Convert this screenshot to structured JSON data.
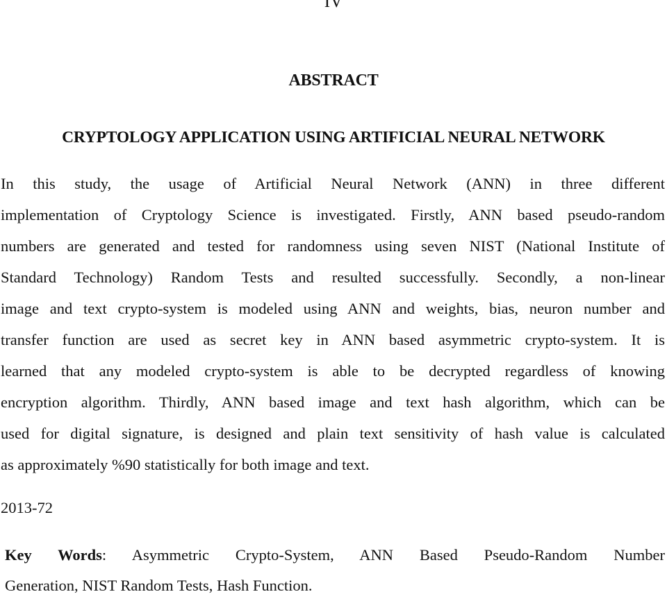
{
  "page": {
    "page_number": "IV"
  },
  "header": {
    "section_heading": "ABSTRACT",
    "thesis_title": "CRYPTOLOGY APPLICATION USING ARTIFICIAL NEURAL NETWORK"
  },
  "abstract": {
    "lines": [
      "In this study, the usage of Artificial Neural Network (ANN) in three different",
      "implementation of Cryptology Science is investigated. Firstly, ANN based pseudo-random",
      "numbers are generated and tested for randomness using seven NIST (National Institute of",
      "Standard Technology) Random Tests and resulted successfully. Secondly, a non-linear",
      "image and text crypto-system is modeled using ANN and weights, bias, neuron number and",
      "transfer function are used as secret key in ANN based asymmetric crypto-system. It is",
      "learned that any modeled crypto-system is able to be decrypted regardless of knowing",
      "encryption algorithm. Thirdly, ANN based image and text hash algorithm, which can be",
      "used for digital signature, is designed and plain text sensitivity of hash value is calculated",
      "as approximately %90 statistically for both image and text."
    ]
  },
  "footer": {
    "code": "2013-72",
    "keywords_label": "Key Words",
    "keywords_separator": ":",
    "keywords_line1": "Asymmetric Crypto-System, ANN Based Pseudo-Random Number",
    "keywords_line2": "Generation, NIST Random Tests, Hash Function."
  }
}
